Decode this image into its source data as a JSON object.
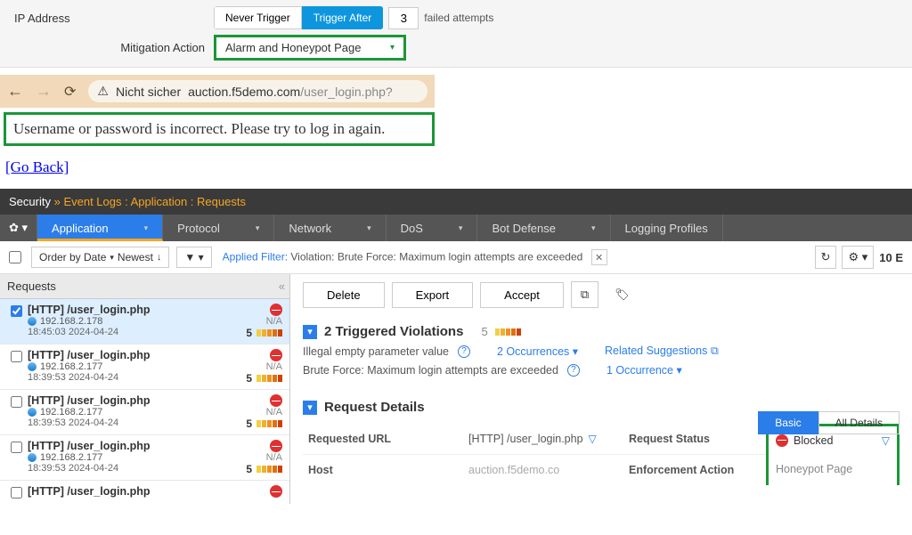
{
  "config": {
    "ip_label": "IP Address",
    "never_trigger": "Never Trigger",
    "trigger_after": "Trigger After",
    "attempts_value": "3",
    "attempts_suffix": "failed attempts",
    "mitigation_label": "Mitigation Action",
    "mitigation_value": "Alarm and Honeypot Page"
  },
  "browser": {
    "insecure_label": "Nicht sicher",
    "url_prefix": "auction.f5demo.com",
    "url_path": "/user_login.php?"
  },
  "error": {
    "msg": "Username or password is incorrect. Please try to log in again.",
    "goback": "[Go Back]"
  },
  "breadcrumb": {
    "sec": "Security",
    "sep": "  »  ",
    "rest": "Event Logs : Application : Requests"
  },
  "tabs": {
    "app": "Application",
    "proto": "Protocol",
    "net": "Network",
    "dos": "DoS",
    "bot": "Bot Defense",
    "log": "Logging Profiles"
  },
  "filter": {
    "order": "Order by Date",
    "newest": "Newest",
    "applied": "Applied Filter:",
    "text": " Violation: Brute Force: Maximum login attempts are exceeded",
    "count": "10"
  },
  "left": {
    "header": "Requests",
    "items": [
      {
        "title": "[HTTP] /user_login.php",
        "ip": "192.168.2.178",
        "time": "18:45:03 2024-04-24",
        "na": "N/A",
        "sev": "5",
        "selected": true,
        "checked": true
      },
      {
        "title": "[HTTP] /user_login.php",
        "ip": "192.168.2.177",
        "time": "18:39:53 2024-04-24",
        "na": "N/A",
        "sev": "5",
        "selected": false,
        "checked": false
      },
      {
        "title": "[HTTP] /user_login.php",
        "ip": "192.168.2.177",
        "time": "18:39:53 2024-04-24",
        "na": "N/A",
        "sev": "5",
        "selected": false,
        "checked": false
      },
      {
        "title": "[HTTP] /user_login.php",
        "ip": "192.168.2.177",
        "time": "18:39:53 2024-04-24",
        "na": "N/A",
        "sev": "5",
        "selected": false,
        "checked": false
      },
      {
        "title": "[HTTP] /user_login.php",
        "ip": "",
        "time": "",
        "na": "",
        "sev": "",
        "selected": false,
        "checked": false
      }
    ]
  },
  "actions": {
    "delete": "Delete",
    "export": "Export",
    "accept": "Accept"
  },
  "violations": {
    "head": "2 Triggered Violations",
    "sev": "5",
    "line1": "Illegal empty parameter value",
    "occ2": "2 Occurrences",
    "related": "Related Suggestions",
    "line2": "Brute Force: Maximum login attempts are exceeded",
    "occ1": "1 Occurrence"
  },
  "details": {
    "head": "Request Details",
    "basic": "Basic",
    "all": "All Details",
    "url_label": "Requested URL",
    "url_val": "[HTTP] /user_login.php",
    "host_label": "Host",
    "host_val": "auction.f5demo.co",
    "status_label": "Request Status",
    "status_val": "Blocked",
    "enf_label": "Enforcement Action",
    "enf_val": "Honeypot Page"
  },
  "right_count_suffix": "E"
}
